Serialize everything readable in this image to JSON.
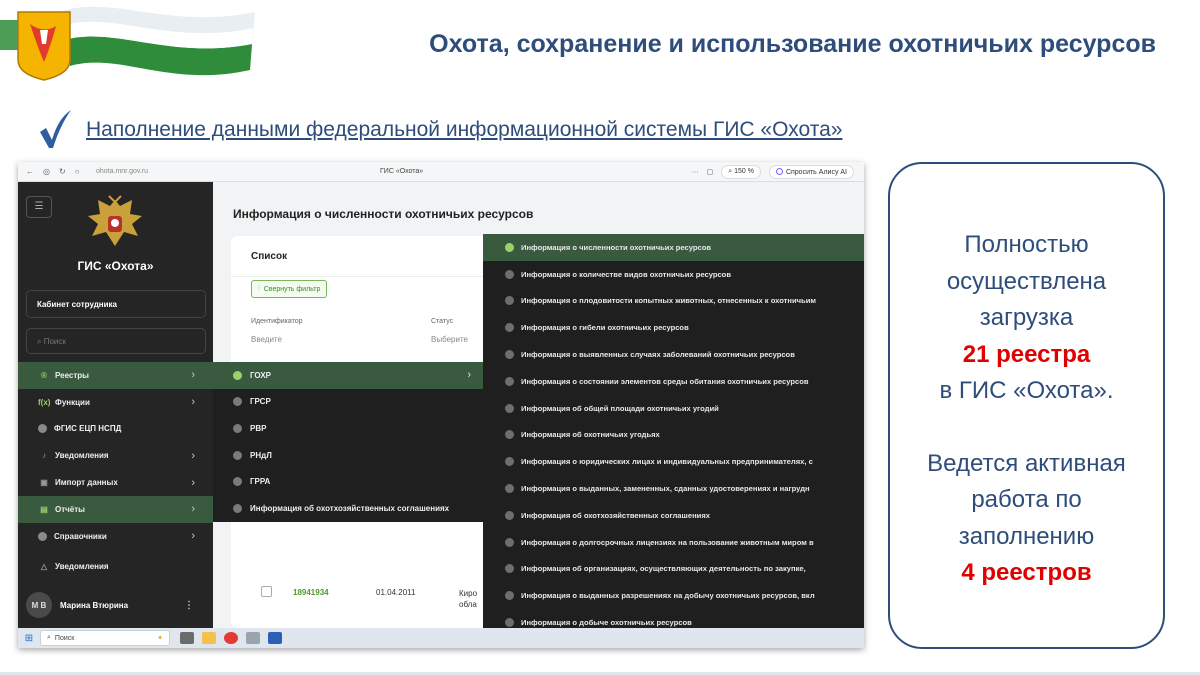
{
  "slide": {
    "title": "Охота, сохранение и использование охотничьих ресурсов",
    "subtitle": "Наполнение данными федеральной информационной системы ГИС «Охота»"
  },
  "browser": {
    "url": "ohota.mnr.gov.ru",
    "tab_title": "ГИС «Охота»",
    "more": "···",
    "zoom": "150 %",
    "ask_alice": "Спросить Алису AI"
  },
  "sidebar": {
    "app_name": "ГИС «Охота»",
    "cabinet_label": "Кабинет сотрудника",
    "search_placeholder": "Поиск",
    "items": [
      {
        "label": "Реестры",
        "icon": "registry-icon",
        "glyph": "®"
      },
      {
        "label": "Функции",
        "icon": "function-icon",
        "glyph": "f(x)"
      },
      {
        "label": "ФГИС ЕЦП НСПД",
        "icon": "dot-icon"
      },
      {
        "label": "Уведомления",
        "icon": "bell-icon",
        "glyph": "🔔"
      },
      {
        "label": "Импорт данных",
        "icon": "import-icon",
        "glyph": "⬚"
      },
      {
        "label": "Отчёты",
        "icon": "report-icon",
        "glyph": "▤"
      },
      {
        "label": "Справочники",
        "icon": "dot-icon"
      }
    ],
    "notifications_label": "Уведомления",
    "user": {
      "initials": "М В",
      "name": "Марина Втюрина"
    }
  },
  "main": {
    "heading": "Информация о численности охотничьих ресурсов",
    "card_title": "Список",
    "filter_button": "Свернуть фильтр",
    "filters": [
      {
        "label": "Идентификатор",
        "value": "Введите"
      },
      {
        "label": "Статус",
        "value": "Выберите"
      }
    ],
    "row": {
      "id": "18941934",
      "date": "01.04.2011",
      "region": "Киро",
      "region2": "обла"
    }
  },
  "registries_submenu": [
    {
      "label": "ГОХР"
    },
    {
      "label": "ГРСР"
    },
    {
      "label": "РВР"
    },
    {
      "label": "РНдЛ"
    },
    {
      "label": "ГРРА"
    },
    {
      "label": "Информация об охотхозяйственных соглашениях"
    }
  ],
  "reports_submenu": [
    "Информация о численности охотничьих ресурсов",
    "Информация о количестве видов охотничьих ресурсов",
    "Информация о плодовитости копытных животных, отнесенных к охотничьим",
    "Информация о гибели охотничьих ресурсов",
    "Информация о выявленных случаях заболеваний охотничьих ресурсов",
    "Информация о состоянии элементов среды обитания охотничьих ресурсов",
    "Информация об общей площади охотничьих угодий",
    "Информация об охотничьих угодьях",
    "Информация о юридических лицах и индивидуальных предпринимателях, с",
    "Информация о выданных, замененных, сданных удостоверениях и нагрудн",
    "Информация об охотхозяйственных соглашениях",
    "Информация о долгосрочных лицензиях на пользование животным миром в",
    "Информация об организациях, осуществляющих деятельность по закупке,",
    "Информация о выданных разрешениях на добычу охотничьих ресурсов, вкл",
    "Информация о добыче охотничьих ресурсов"
  ],
  "taskbar": {
    "search_placeholder": "Поиск"
  },
  "info_box": {
    "line1": "Полностью",
    "line2": "осуществлена",
    "line3": "загрузка",
    "highlight1": "21 реестра",
    "line4": "в ГИС «Охота».",
    "line5": "Ведется активная",
    "line6": "работа по",
    "line7": "заполнению",
    "highlight2": "4 реестров"
  },
  "colors": {
    "accent_blue": "#2e4d7b",
    "highlight_red": "#e00000",
    "sidebar_bg": "#252525",
    "active_green": "#3a5a3f",
    "link_green": "#4d9a2c"
  }
}
